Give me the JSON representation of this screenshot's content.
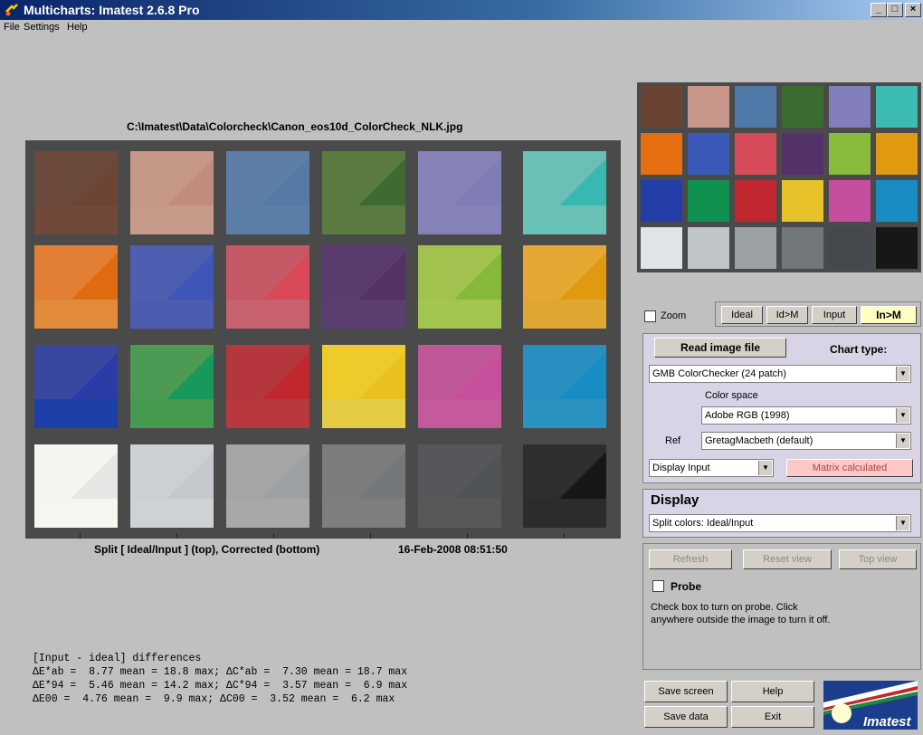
{
  "window": {
    "title": "Multicharts: Imatest 2.6.8 Pro"
  },
  "menu": [
    "File",
    "Settings",
    "Help"
  ],
  "image": {
    "filepath": "C:\\Imatest\\Data\\Colorcheck\\Canon_eos10d_ColorCheck_NLK.jpg",
    "caption": "Split [ Ideal/Input ] (top), Corrected (bottom)",
    "timestamp": "16-Feb-2008 08:51:50"
  },
  "patches": [
    {
      "a": "#6b4a3c",
      "b": "#6d4535",
      "c": "#70493a"
    },
    {
      "a": "#c69888",
      "b": "#c28c7c",
      "c": "#c89a8a"
    },
    {
      "a": "#5d7ea6",
      "b": "#557aa6",
      "c": "#5a7ea6"
    },
    {
      "a": "#5b7a40",
      "b": "#3f6a30",
      "c": "#5b7a3f"
    },
    {
      "a": "#8682b8",
      "b": "#807cb5",
      "c": "#8582b8"
    },
    {
      "a": "#6ac0b4",
      "b": "#38b8b0",
      "c": "#6ac2b6"
    },
    {
      "a": "#e27f34",
      "b": "#e06c12",
      "c": "#e08a3a"
    },
    {
      "a": "#4e5eb0",
      "b": "#3f56b8",
      "c": "#4c5cb0"
    },
    {
      "a": "#c75866",
      "b": "#d84a58",
      "c": "#c86270"
    },
    {
      "a": "#5a3c6e",
      "b": "#553266",
      "c": "#5a3e70"
    },
    {
      "a": "#a2c250",
      "b": "#86b83a",
      "c": "#a2c650"
    },
    {
      "a": "#e5a632",
      "b": "#e09a10",
      "c": "#e0a632"
    },
    {
      "a": "#3848a0",
      "b": "#2a3ca8",
      "c": "#1c40a8"
    },
    {
      "a": "#4b9b54",
      "b": "#18985a",
      "c": "#469a50"
    },
    {
      "a": "#b5363c",
      "b": "#c0282e",
      "c": "#b8383e"
    },
    {
      "a": "#eccb2a",
      "b": "#e8c020",
      "c": "#e6cc44"
    },
    {
      "a": "#c05898",
      "b": "#c84e9e",
      "c": "#c45a9c"
    },
    {
      "a": "#2890c0",
      "b": "#1a8cc4",
      "c": "#2a92c0"
    },
    {
      "a": "#f5f5f0",
      "b": "#e6e6e4",
      "c": "#f6f6f0"
    },
    {
      "a": "#cdd0d2",
      "b": "#c4c8cc",
      "c": "#cfd2d4"
    },
    {
      "a": "#a3a5a6",
      "b": "#9ca0a2",
      "c": "#a6a8aa"
    },
    {
      "a": "#7b7d7f",
      "b": "#74787a",
      "c": "#7c7e80"
    },
    {
      "a": "#55575a",
      "b": "#505456",
      "c": "#56585a"
    },
    {
      "a": "#2e2e30",
      "b": "#161818",
      "c": "#2c2c2e"
    }
  ],
  "thumbnail": [
    "#6b4332",
    "#c8968a",
    "#4f79a8",
    "#3c6b31",
    "#827ebb",
    "#3bbbb2",
    "#e46e10",
    "#3a59b8",
    "#d84b5b",
    "#55316a",
    "#88bc3a",
    "#e09a10",
    "#233ea8",
    "#119150",
    "#c2262e",
    "#e7c22a",
    "#c54f9e",
    "#1a8cc4",
    "#e0e4e6",
    "#c0c5ca",
    "#9ba0a4",
    "#72777c",
    "#45494e",
    "#161818"
  ],
  "view_buttons": {
    "zoom_label": "Zoom",
    "ideal": "Ideal",
    "id_m": "Id>M",
    "input": "Input",
    "in_m": "In>M"
  },
  "controls": {
    "read_image": "Read image file",
    "chart_type_label": "Chart type:",
    "chart_type": "GMB ColorChecker (24 patch)",
    "color_space_label": "Color space",
    "color_space": "Adobe RGB (1998)",
    "ref_label": "Ref",
    "ref": "GretagMacbeth (default)",
    "display_input": "Display Input",
    "matrix": "Matrix calculated"
  },
  "display": {
    "title": "Display",
    "mode": "Split colors: Ideal/Input"
  },
  "probe": {
    "refresh": "Refresh",
    "reset": "Reset view",
    "top": "Top view",
    "label": "Probe",
    "help1": "Check box to turn on probe. Click",
    "help2": "anywhere outside the image to turn it off."
  },
  "stats": {
    "header": "[Input - ideal] differences",
    "r1a": "ΔE*ab",
    "r1b": " =  8.77 mean = 18.8 max; ",
    "r1c": "ΔC*ab",
    "r1d": " =  7.30 mean = 18.7 max",
    "r2a": "ΔE*94",
    "r2b": " =  5.46 mean = 14.2 max; ",
    "r2c": "ΔC*94",
    "r2d": " =  3.57 mean =  6.9 max",
    "r3a": "ΔE00",
    "r3b": " =  4.76 mean =  9.9 max; ",
    "r3c": "ΔC00",
    "r3d": " =  3.52 mean =  6.2 max"
  },
  "bottom_buttons": {
    "save_screen": "Save screen",
    "help": "Help",
    "save_data": "Save data",
    "exit": "Exit"
  },
  "logo": {
    "text": "Imatest"
  }
}
